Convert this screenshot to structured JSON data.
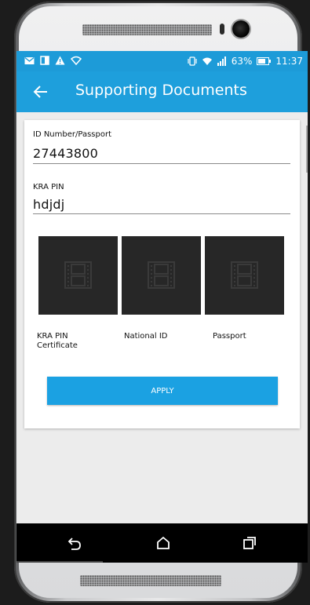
{
  "status_bar": {
    "battery_percent": "63%",
    "time": "11:37",
    "icons": [
      "email-icon",
      "screen-icon",
      "warning-icon",
      "wifi-outline-icon",
      "vibrate-icon",
      "wifi-icon",
      "signal-icon",
      "battery-icon"
    ]
  },
  "app_bar": {
    "title": "Supporting Documents",
    "back_icon": "arrow-back-icon"
  },
  "form": {
    "id_label": "ID Number/Passport",
    "id_value": "27443800",
    "kra_label": "KRA PIN",
    "kra_value": "hdjdj"
  },
  "documents": [
    {
      "label": "KRA PIN Certificate",
      "icon": "film-placeholder-icon"
    },
    {
      "label": "National ID",
      "icon": "film-placeholder-icon"
    },
    {
      "label": "Passport",
      "icon": "film-placeholder-icon"
    }
  ],
  "apply_label": "APPLY",
  "nav_bar": [
    "back-icon",
    "home-icon",
    "recents-icon"
  ],
  "colors": {
    "primary": "#1e9fdc",
    "status_bar": "#1d9bd8",
    "button": "#1ba1e2",
    "thumbnail": "#272727"
  }
}
